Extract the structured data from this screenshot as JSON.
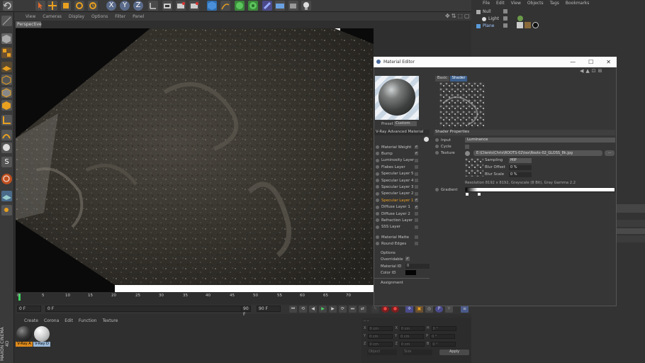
{
  "viewport_menu": [
    "View",
    "Cameras",
    "Display",
    "Options",
    "Filter",
    "Panel"
  ],
  "viewport_label": "Perspective",
  "timeline_ticks": [
    "0",
    "5",
    "10",
    "15",
    "20",
    "25",
    "30",
    "35",
    "40",
    "45",
    "50",
    "55",
    "60",
    "65",
    "70"
  ],
  "transport": {
    "start": "0 F",
    "current": "0 F",
    "end_a": "90 F",
    "end_b": "90 F"
  },
  "material_menu": [
    "Create",
    "Corona",
    "Edit",
    "Function",
    "Texture"
  ],
  "materials": [
    {
      "label": "V-Ray A",
      "color": "#dd8a1c"
    },
    {
      "label": "V-Ray D",
      "color": "#9ab8d8"
    }
  ],
  "coords": {
    "rows": [
      {
        "axis": "X",
        "v1": "0 cm",
        "a2": "X",
        "v2": "0 cm",
        "a3": "H",
        "v3": "0 °"
      },
      {
        "axis": "Y",
        "v1": "0 cm",
        "a2": "Y",
        "v2": "0 cm",
        "a3": "P",
        "v3": "0 °"
      },
      {
        "axis": "Z",
        "v1": "0 cm",
        "a2": "Z",
        "v2": "0 cm",
        "a3": "B",
        "v3": "0 °"
      }
    ],
    "mode1": "Object",
    "mode2": "Size",
    "apply": "Apply"
  },
  "object_menu": [
    "File",
    "Edit",
    "View",
    "Objects",
    "Tags",
    "Bookmarks"
  ],
  "objects": [
    {
      "name": "Null",
      "color": "#c9c9c9"
    },
    {
      "name": "Light",
      "color": "#c9c9c9"
    },
    {
      "name": "Plane",
      "color": "#9fc7ff"
    }
  ],
  "material_editor": {
    "title": "Material Editor",
    "controls": [
      "—",
      "☐",
      "✕"
    ],
    "preset_label": "Preset",
    "preset_value": "Custom",
    "material_type": "V-Ray Advanced Material",
    "channels": [
      {
        "label": "Material Weight",
        "checked": true
      },
      {
        "label": "Bump",
        "checked": true
      },
      {
        "label": "Luminosity Layer",
        "checked": false
      },
      {
        "label": "Flakes Layer",
        "checked": false
      },
      {
        "label": "Specular Layer 5",
        "checked": false
      },
      {
        "label": "Specular Layer 4",
        "checked": false
      },
      {
        "label": "Specular Layer 3",
        "checked": false
      },
      {
        "label": "Specular Layer 2",
        "checked": false
      },
      {
        "label": "Specular Layer 1",
        "checked": true,
        "active": true
      },
      {
        "label": "Diffuse Layer 1",
        "checked": true
      },
      {
        "label": "Diffuse Layer 2",
        "checked": false
      },
      {
        "label": "Refraction Layer",
        "checked": false
      },
      {
        "label": "SSS Layer",
        "checked": false
      }
    ],
    "channels2": [
      {
        "label": "Material Matte",
        "checked": false
      },
      {
        "label": "Round Edges",
        "checked": false
      }
    ],
    "options": {
      "title": "Options",
      "overridable": "Overridable",
      "material_id": "Material ID",
      "material_id_value": "0",
      "color_id": "Color ID"
    },
    "assignment": "Assignment",
    "tabs": [
      "Basic",
      "Shader"
    ],
    "shader_properties": "Shader Properties",
    "input_label": "Input",
    "input_value": "Luminance",
    "cycle_label": "Cycle",
    "texture_label": "Texture",
    "texture_path": "E:\\Clients\\Chris\\ROOTS-02\\tex\\Roots-02_GLOSS_8k.jpg",
    "sampling_label": "Sampling",
    "sampling_value": "MIP",
    "blur_offset_label": "Blur Offset",
    "blur_offset_value": "0 %",
    "blur_scale_label": "Blur Scale",
    "blur_scale_value": "0 %",
    "resolution": "Resolution 8192 x 8192, Grayscale (8 Bit), Gray Gamma 2.2",
    "gradient_label": "Gradient"
  }
}
